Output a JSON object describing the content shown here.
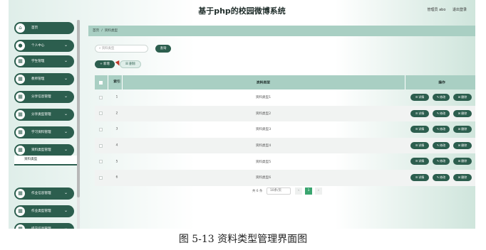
{
  "header": {
    "title": "基于php的校园微博系统",
    "user_label": "管理员 abo",
    "logout_label": "退出登录"
  },
  "sidebar": {
    "items": [
      {
        "label": "首页",
        "icon": "home-icon",
        "glyph": "⌂",
        "has_children": false
      },
      {
        "label": "个人中心",
        "icon": "user-icon",
        "glyph": "●",
        "has_children": true
      },
      {
        "label": "学生管理",
        "icon": "grid-icon",
        "glyph": "▦",
        "has_children": true
      },
      {
        "label": "教师管理",
        "icon": "grid-icon",
        "glyph": "▦",
        "has_children": true
      },
      {
        "label": "分享信息管理",
        "icon": "grid-icon",
        "glyph": "▦",
        "has_children": true
      },
      {
        "label": "分享类型管理",
        "icon": "grid-icon",
        "glyph": "▦",
        "has_children": true
      },
      {
        "label": "学习资料管理",
        "icon": "grid-icon",
        "glyph": "▦",
        "has_children": true
      },
      {
        "label": "资料类型管理",
        "icon": "grid-icon",
        "glyph": "▦",
        "has_children": true
      },
      {
        "label": "作业信息管理",
        "icon": "grid-icon",
        "glyph": "▦",
        "has_children": true
      },
      {
        "label": "作业类型管理",
        "icon": "grid-icon",
        "glyph": "▦",
        "has_children": true
      },
      {
        "label": "提交信息管理",
        "icon": "grid-icon",
        "glyph": "▦",
        "has_children": true
      }
    ],
    "active_subitem": "资料类型",
    "chevron_glyph": "⌄"
  },
  "breadcrumb": {
    "root": "首页",
    "separator": "/",
    "current": "资料类型"
  },
  "search": {
    "placeholder": "资料类型",
    "button_label": "查询",
    "icon_glyph": "⌕"
  },
  "actions": {
    "add_label": "+ 新增",
    "delete_label": "删除",
    "delete_glyph": "☒"
  },
  "table": {
    "columns": {
      "index": "索引",
      "name": "资料类型",
      "ops": "操作"
    },
    "rows": [
      {
        "index": "1",
        "name": "资料类型1"
      },
      {
        "index": "2",
        "name": "资料类型2"
      },
      {
        "index": "3",
        "name": "资料类型3"
      },
      {
        "index": "4",
        "name": "资料类型4"
      },
      {
        "index": "5",
        "name": "资料类型5"
      },
      {
        "index": "6",
        "name": "资料类型6"
      }
    ],
    "row_buttons": {
      "detail": "详情",
      "edit": "修改",
      "delete": "删除"
    },
    "row_button_glyphs": {
      "detail": "☰",
      "edit": "✎",
      "delete": "☒"
    }
  },
  "pagination": {
    "total": "共 6 条",
    "page_size": "10条/页",
    "current_page": "1",
    "prev": "‹",
    "next": "›"
  },
  "caption": "图 5-13 资料类型管理界面图",
  "colors": {
    "primary": "#2c5e4e",
    "header_row": "#a9cfc3",
    "pager_active": "#3aa56f"
  }
}
